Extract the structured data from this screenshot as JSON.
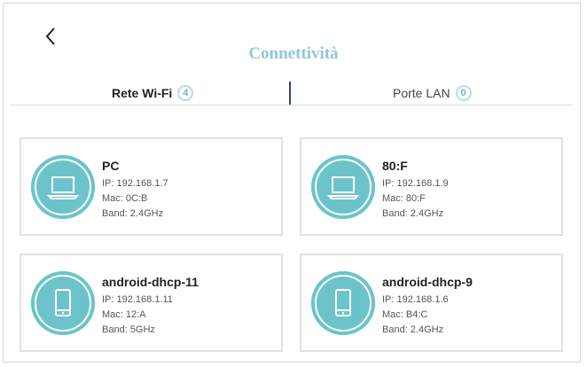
{
  "page": {
    "title": "Connettività"
  },
  "tabs": [
    {
      "label": "Rete Wi-Fi",
      "count": "4"
    },
    {
      "label": "Porte LAN",
      "count": "0"
    }
  ],
  "devices": [
    {
      "name": "PC",
      "ip": "IP: 192.168.1.7",
      "mac": "Mac: 0C:B",
      "band": "Band: 2.4GHz",
      "icon": "laptop-icon"
    },
    {
      "name": "80:F",
      "ip": "IP: 192.168.1.9",
      "mac": "Mac: 80:F",
      "band": "Band: 2.4GHz",
      "icon": "laptop-icon"
    },
    {
      "name": "android-dhcp-11",
      "ip": "IP: 192.168.1.11",
      "mac": "Mac: 12:A",
      "band": "Band: 5GHz",
      "icon": "phone-icon"
    },
    {
      "name": "android-dhcp-9",
      "ip": "IP: 192.168.1.6",
      "mac": "Mac: B4:C",
      "band": "Band: 2.4GHz",
      "icon": "phone-icon"
    }
  ],
  "colors": {
    "accent": "#6cc4ca",
    "title": "#8fc9d3",
    "divider": "#2e4a6a"
  }
}
